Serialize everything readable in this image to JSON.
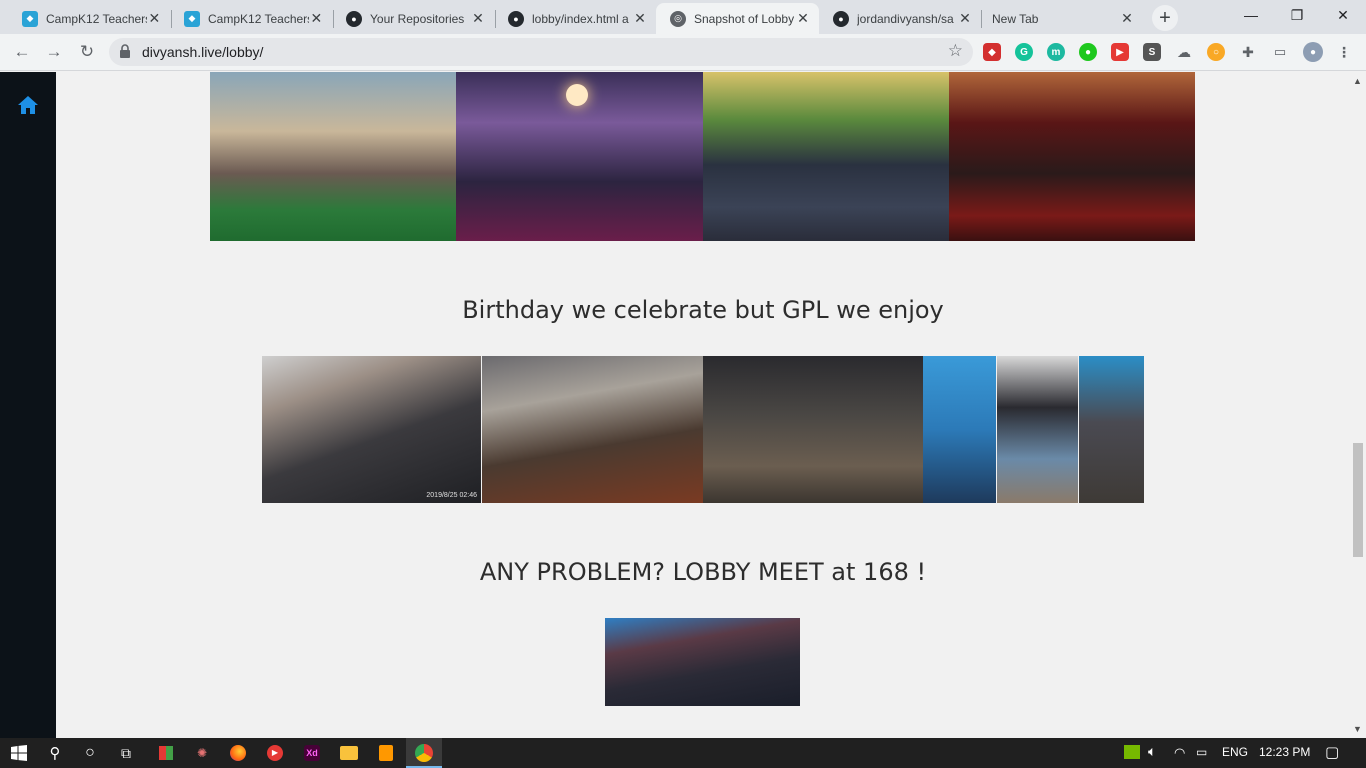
{
  "browser": {
    "tabs": [
      {
        "label": "CampK12 Teachers",
        "favicon": "campk12-icon",
        "color": "#e8eaed"
      },
      {
        "label": "CampK12 Teachers",
        "favicon": "campk12-icon",
        "color": "#e8eaed"
      },
      {
        "label": "Your Repositories",
        "favicon": "github-icon",
        "color": "#e8eaed"
      },
      {
        "label": "lobby/index.html a",
        "favicon": "github-icon",
        "color": "#e8eaed"
      },
      {
        "label": "Snapshot of Lobby",
        "favicon": "globe-icon",
        "color": "#f1f3f4"
      },
      {
        "label": "jordandivyansh/sa",
        "favicon": "github-icon",
        "color": "#e8eaed"
      },
      {
        "label": "New Tab",
        "favicon": "",
        "color": "#e8eaed"
      }
    ],
    "url": "divyansh.live/lobby/"
  },
  "page": {
    "caption_birthday": "Birthday we celebrate but GPL we enjoy",
    "caption_lobby": "ANY PROBLEM? LOBBY MEET at 168 !",
    "photo_timestamp": "2019/8/25 02:46"
  },
  "taskbar": {
    "language": "ENG",
    "time": "12:23 PM"
  }
}
